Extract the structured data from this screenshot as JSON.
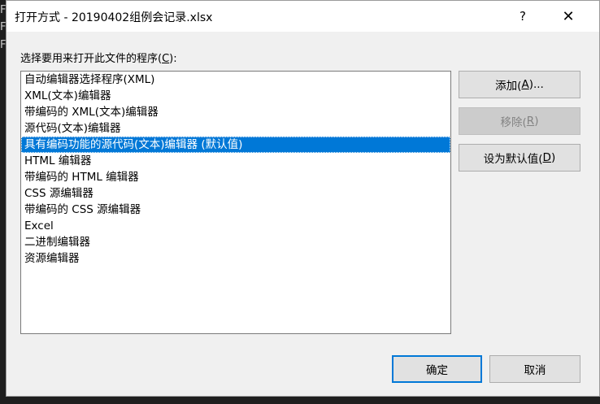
{
  "window": {
    "title": "打开方式 - 20190402组例会记录.xlsx",
    "help_glyph": "?",
    "close_glyph": "✕"
  },
  "prompt": {
    "text_before": "选择要用来打开此文件的程序(",
    "hotkey": "C",
    "text_after": "):"
  },
  "programs": [
    "自动编辑器选择程序(XML)",
    "XML(文本)编辑器",
    "带编码的 XML(文本)编辑器",
    "源代码(文本)编辑器",
    "具有编码功能的源代码(文本)编辑器 (默认值)",
    "HTML 编辑器",
    "带编码的 HTML 编辑器",
    "CSS 源编辑器",
    "带编码的 CSS 源编辑器",
    "Excel",
    "二进制编辑器",
    "资源编辑器"
  ],
  "selected_index": 4,
  "buttons": {
    "add": {
      "before": "添加(",
      "hotkey": "A",
      "after": ")..."
    },
    "remove": {
      "before": "移除(",
      "hotkey": "R",
      "after": ")"
    },
    "set_default": {
      "before": "设为默认值(",
      "hotkey": "D",
      "after": ")"
    },
    "ok": "确定",
    "cancel": "取消"
  },
  "background_glyphs": [
    "F",
    "F",
    "F"
  ],
  "colors": {
    "selection": "#0078d7",
    "default_button_border": "#0078d7",
    "dialog_bg": "#f0f0f0"
  }
}
